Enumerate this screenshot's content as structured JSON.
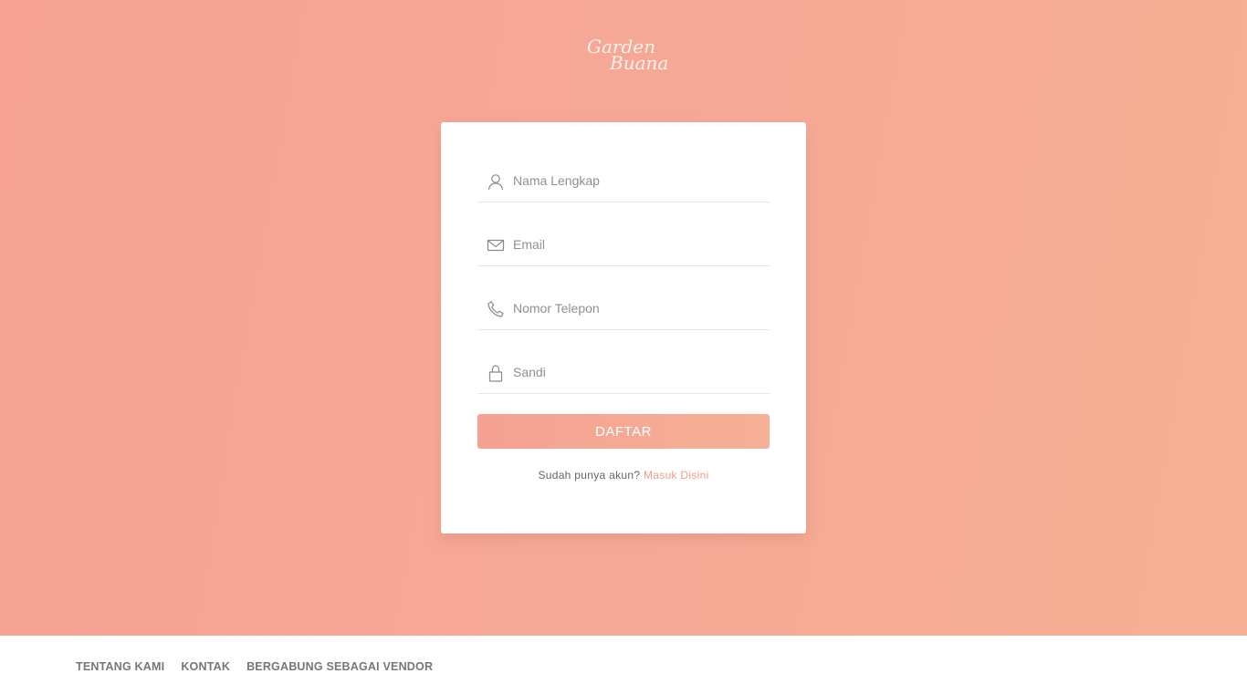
{
  "brand": {
    "line1": "Garden",
    "line2": "Buana"
  },
  "form": {
    "fields": [
      {
        "placeholder": "Nama Lengkap",
        "icon": "user-icon",
        "value": ""
      },
      {
        "placeholder": "Email",
        "icon": "envelope-icon",
        "value": ""
      },
      {
        "placeholder": "Nomor Telepon",
        "icon": "phone-icon",
        "value": ""
      },
      {
        "placeholder": "Sandi",
        "icon": "lock-icon",
        "value": ""
      }
    ],
    "submit_label": "DAFTAR",
    "signin_prompt": "Sudah punya akun?",
    "signin_link": "Masuk Disini"
  },
  "footer": {
    "links": [
      "TENTANG KAMI",
      "KONTAK",
      "BERGABUNG SEBAGAI VENDOR"
    ]
  },
  "colors": {
    "background_start": "#f6a394",
    "background_end": "#f5b094",
    "accent": "#f39c8c",
    "button": "#f5a193"
  }
}
